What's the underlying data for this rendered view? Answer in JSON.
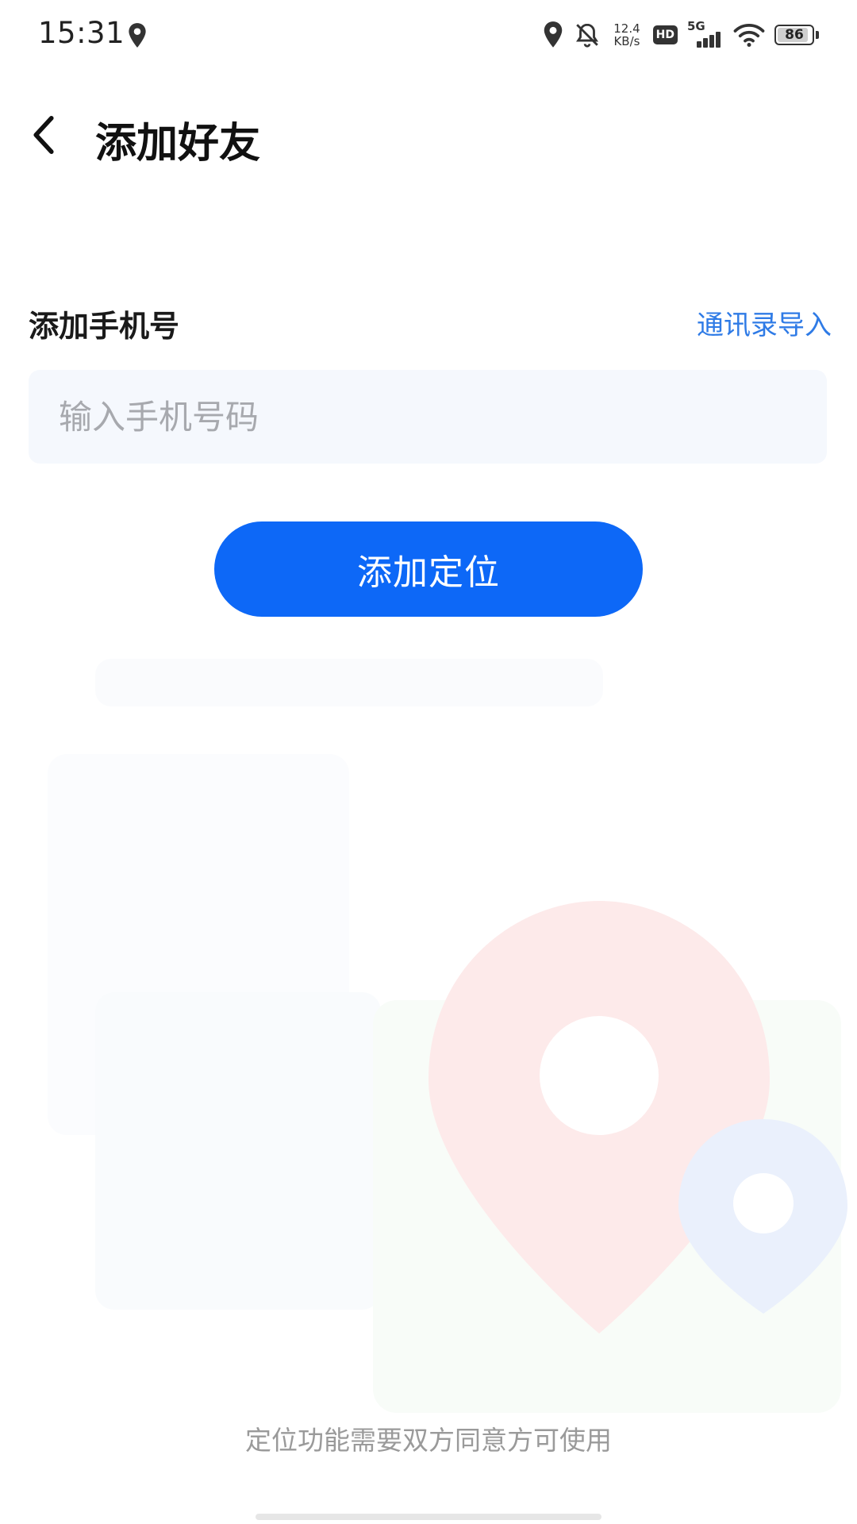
{
  "status_bar": {
    "time": "15:31",
    "net_speed_value": "12.4",
    "net_speed_unit": "KB/s",
    "hd_label": "HD",
    "network_label": "5G",
    "battery_level": "86",
    "icons": [
      "location-icon",
      "location-icon",
      "bell-off-icon",
      "signal-icon",
      "wifi-icon",
      "battery-icon"
    ]
  },
  "header": {
    "back_icon": "chevron-left-icon",
    "title": "添加好友"
  },
  "form": {
    "section_label": "添加手机号",
    "import_link": "通讯录导入",
    "phone_placeholder": "输入手机号码",
    "submit_label": "添加定位"
  },
  "footer": {
    "note": "定位功能需要双方同意方可使用"
  },
  "colors": {
    "primary": "#0d68f7",
    "link": "#2f7be6",
    "input_bg": "#f5f8fd",
    "pin_red": "#fde8e8",
    "pin_blue": "#e8effc"
  }
}
